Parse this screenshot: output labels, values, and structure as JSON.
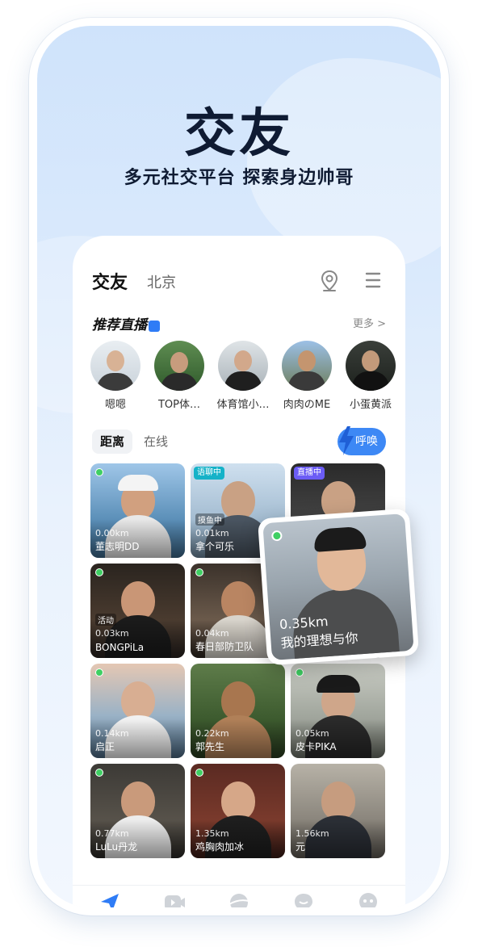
{
  "hero": {
    "title": "交友",
    "subtitle": "多元社交平台 探索身边帅哥"
  },
  "header": {
    "active_tab": "交友",
    "city": "北京"
  },
  "icons": {
    "location": "location-pin-icon",
    "menu": "menu-lines-icon"
  },
  "live": {
    "title": "推荐直播",
    "more": "更多 >",
    "items": [
      {
        "name": "嗯嗯"
      },
      {
        "name": "TOP体…"
      },
      {
        "name": "体育馆小…"
      },
      {
        "name": "肉肉のME"
      },
      {
        "name": "小蛋黄派"
      }
    ]
  },
  "filters": {
    "active": "距离",
    "other": "在线",
    "call_button": "呼唤"
  },
  "grid": [
    {
      "distance": "0.00km",
      "name": "董志明DD",
      "online": true
    },
    {
      "distance": "0.01km",
      "name": "拿个可乐",
      "online": false,
      "badge": "语聊中",
      "tag": "摸鱼中"
    },
    {
      "distance": "",
      "name": "",
      "online": false,
      "badge": "直播中"
    },
    {
      "distance": "0.03km",
      "name": "BONGPiLa",
      "online": true,
      "tag": "活动"
    },
    {
      "distance": "0.04km",
      "name": "春日部防卫队",
      "online": true
    },
    {
      "distance": "",
      "name": "",
      "online": false
    },
    {
      "distance": "0.14km",
      "name": "启正",
      "online": true
    },
    {
      "distance": "0.22km",
      "name": "郭先生",
      "online": false
    },
    {
      "distance": "0.05km",
      "name": "皮卡PIKA",
      "online": true
    },
    {
      "distance": "0.77km",
      "name": "LuLu丹龙",
      "online": true
    },
    {
      "distance": "1.35km",
      "name": "鸡胸肉加冰",
      "online": true
    },
    {
      "distance": "1.56km",
      "name": "元",
      "online": false
    }
  ],
  "featured": {
    "distance": "0.35km",
    "name": "我的理想与你",
    "online": true
  },
  "tabbar": [
    {
      "label": "身边",
      "active": true
    },
    {
      "label": "直播",
      "active": false
    },
    {
      "label": "发现",
      "active": false
    },
    {
      "label": "消息",
      "active": false
    },
    {
      "label": "我的",
      "active": false
    }
  ],
  "colors": {
    "accent": "#3d88f5",
    "online": "#3fcf63",
    "title": "#0f1b33"
  }
}
